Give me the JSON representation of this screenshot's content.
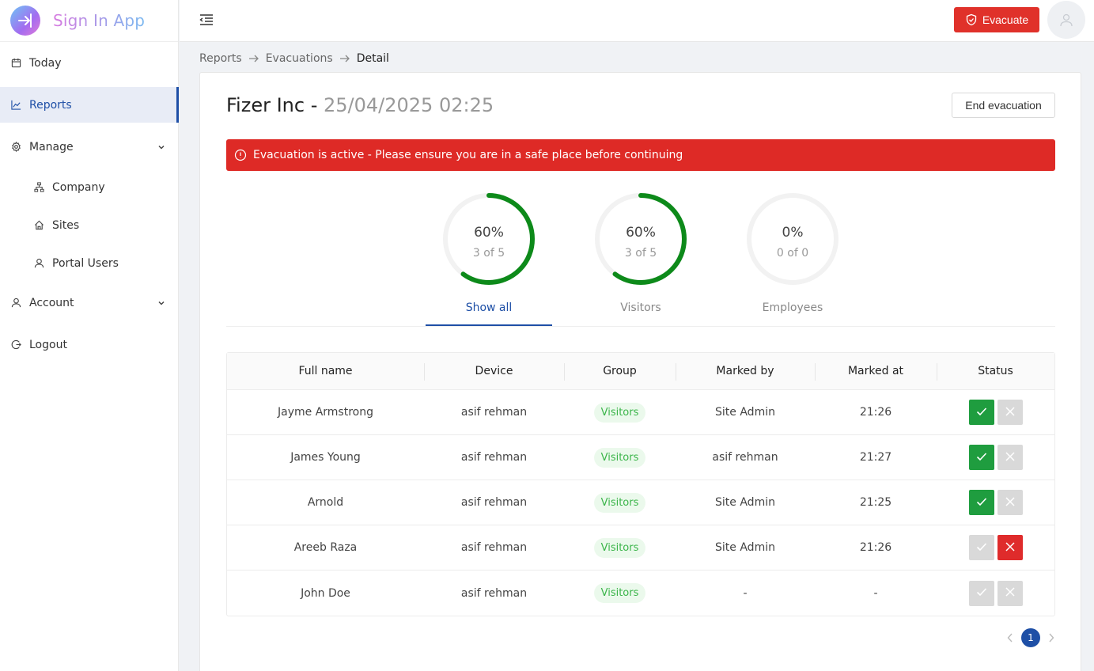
{
  "app": {
    "name": "Sign In App"
  },
  "sidebar": {
    "items": [
      {
        "label": "Today",
        "icon": "calendar-icon"
      },
      {
        "label": "Reports",
        "icon": "line-chart-icon",
        "active": true
      },
      {
        "label": "Manage",
        "icon": "gear-icon",
        "expandable": true
      },
      {
        "label": "Company",
        "icon": "org-chart-icon",
        "sub": true
      },
      {
        "label": "Sites",
        "icon": "home-icon",
        "sub": true
      },
      {
        "label": "Portal Users",
        "icon": "user-icon",
        "sub": true
      },
      {
        "label": "Account",
        "icon": "user-icon",
        "expandable": true
      },
      {
        "label": "Logout",
        "icon": "logout-icon"
      }
    ]
  },
  "header": {
    "evacuate_label": "Evacuate"
  },
  "breadcrumb": [
    "Reports",
    "Evacuations",
    "Detail"
  ],
  "page": {
    "company": "Fizer Inc",
    "separator": " - ",
    "datetime": "25/04/2025 02:25",
    "end_button": "End evacuation",
    "alert": "Evacuation is active - Please ensure you are in a safe place before continuing"
  },
  "tabs": [
    {
      "label": "Show all",
      "percent": "60%",
      "count": "3 of 5",
      "fraction": 0.6,
      "active": true
    },
    {
      "label": "Visitors",
      "percent": "60%",
      "count": "3 of 5",
      "fraction": 0.6,
      "active": false
    },
    {
      "label": "Employees",
      "percent": "0%",
      "count": "0 of 0",
      "fraction": 0,
      "active": false
    }
  ],
  "table": {
    "columns": [
      "Full name",
      "Device",
      "Group",
      "Marked by",
      "Marked at",
      "Status"
    ],
    "rows": [
      {
        "name": "Jayme Armstrong",
        "device": "asif rehman",
        "group": "Visitors",
        "marked_by": "Site Admin",
        "marked_at": "21:26",
        "status": "safe"
      },
      {
        "name": "James Young",
        "device": "asif rehman",
        "group": "Visitors",
        "marked_by": "asif rehman",
        "marked_at": "21:27",
        "status": "safe"
      },
      {
        "name": "Arnold",
        "device": "asif rehman",
        "group": "Visitors",
        "marked_by": "Site Admin",
        "marked_at": "21:25",
        "status": "safe"
      },
      {
        "name": "Areeb Raza",
        "device": "asif rehman",
        "group": "Visitors",
        "marked_by": "Site Admin",
        "marked_at": "21:26",
        "status": "unsafe"
      },
      {
        "name": "John Doe",
        "device": "asif rehman",
        "group": "Visitors",
        "marked_by": "-",
        "marked_at": "-",
        "status": "unmarked"
      }
    ]
  },
  "pagination": {
    "current": "1"
  },
  "colors": {
    "primary": "#1e4fa6",
    "danger": "#de2a26",
    "success": "#1f9d3f",
    "ring": "#0d8a1a"
  }
}
